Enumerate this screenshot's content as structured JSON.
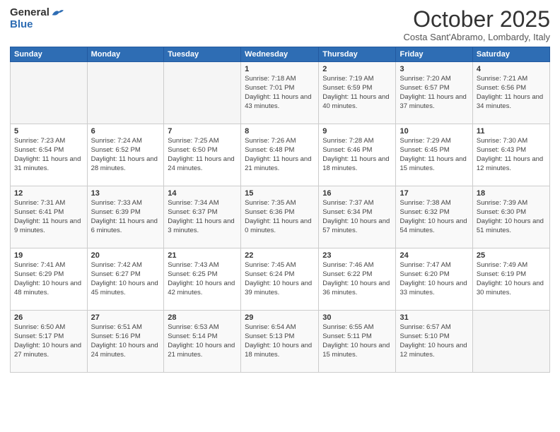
{
  "header": {
    "logo_general": "General",
    "logo_blue": "Blue",
    "month": "October 2025",
    "location": "Costa Sant'Abramo, Lombardy, Italy"
  },
  "days_of_week": [
    "Sunday",
    "Monday",
    "Tuesday",
    "Wednesday",
    "Thursday",
    "Friday",
    "Saturday"
  ],
  "weeks": [
    [
      {
        "day": "",
        "info": ""
      },
      {
        "day": "",
        "info": ""
      },
      {
        "day": "",
        "info": ""
      },
      {
        "day": "1",
        "info": "Sunrise: 7:18 AM\nSunset: 7:01 PM\nDaylight: 11 hours and 43 minutes."
      },
      {
        "day": "2",
        "info": "Sunrise: 7:19 AM\nSunset: 6:59 PM\nDaylight: 11 hours and 40 minutes."
      },
      {
        "day": "3",
        "info": "Sunrise: 7:20 AM\nSunset: 6:57 PM\nDaylight: 11 hours and 37 minutes."
      },
      {
        "day": "4",
        "info": "Sunrise: 7:21 AM\nSunset: 6:56 PM\nDaylight: 11 hours and 34 minutes."
      }
    ],
    [
      {
        "day": "5",
        "info": "Sunrise: 7:23 AM\nSunset: 6:54 PM\nDaylight: 11 hours and 31 minutes."
      },
      {
        "day": "6",
        "info": "Sunrise: 7:24 AM\nSunset: 6:52 PM\nDaylight: 11 hours and 28 minutes."
      },
      {
        "day": "7",
        "info": "Sunrise: 7:25 AM\nSunset: 6:50 PM\nDaylight: 11 hours and 24 minutes."
      },
      {
        "day": "8",
        "info": "Sunrise: 7:26 AM\nSunset: 6:48 PM\nDaylight: 11 hours and 21 minutes."
      },
      {
        "day": "9",
        "info": "Sunrise: 7:28 AM\nSunset: 6:46 PM\nDaylight: 11 hours and 18 minutes."
      },
      {
        "day": "10",
        "info": "Sunrise: 7:29 AM\nSunset: 6:45 PM\nDaylight: 11 hours and 15 minutes."
      },
      {
        "day": "11",
        "info": "Sunrise: 7:30 AM\nSunset: 6:43 PM\nDaylight: 11 hours and 12 minutes."
      }
    ],
    [
      {
        "day": "12",
        "info": "Sunrise: 7:31 AM\nSunset: 6:41 PM\nDaylight: 11 hours and 9 minutes."
      },
      {
        "day": "13",
        "info": "Sunrise: 7:33 AM\nSunset: 6:39 PM\nDaylight: 11 hours and 6 minutes."
      },
      {
        "day": "14",
        "info": "Sunrise: 7:34 AM\nSunset: 6:37 PM\nDaylight: 11 hours and 3 minutes."
      },
      {
        "day": "15",
        "info": "Sunrise: 7:35 AM\nSunset: 6:36 PM\nDaylight: 11 hours and 0 minutes."
      },
      {
        "day": "16",
        "info": "Sunrise: 7:37 AM\nSunset: 6:34 PM\nDaylight: 10 hours and 57 minutes."
      },
      {
        "day": "17",
        "info": "Sunrise: 7:38 AM\nSunset: 6:32 PM\nDaylight: 10 hours and 54 minutes."
      },
      {
        "day": "18",
        "info": "Sunrise: 7:39 AM\nSunset: 6:30 PM\nDaylight: 10 hours and 51 minutes."
      }
    ],
    [
      {
        "day": "19",
        "info": "Sunrise: 7:41 AM\nSunset: 6:29 PM\nDaylight: 10 hours and 48 minutes."
      },
      {
        "day": "20",
        "info": "Sunrise: 7:42 AM\nSunset: 6:27 PM\nDaylight: 10 hours and 45 minutes."
      },
      {
        "day": "21",
        "info": "Sunrise: 7:43 AM\nSunset: 6:25 PM\nDaylight: 10 hours and 42 minutes."
      },
      {
        "day": "22",
        "info": "Sunrise: 7:45 AM\nSunset: 6:24 PM\nDaylight: 10 hours and 39 minutes."
      },
      {
        "day": "23",
        "info": "Sunrise: 7:46 AM\nSunset: 6:22 PM\nDaylight: 10 hours and 36 minutes."
      },
      {
        "day": "24",
        "info": "Sunrise: 7:47 AM\nSunset: 6:20 PM\nDaylight: 10 hours and 33 minutes."
      },
      {
        "day": "25",
        "info": "Sunrise: 7:49 AM\nSunset: 6:19 PM\nDaylight: 10 hours and 30 minutes."
      }
    ],
    [
      {
        "day": "26",
        "info": "Sunrise: 6:50 AM\nSunset: 5:17 PM\nDaylight: 10 hours and 27 minutes."
      },
      {
        "day": "27",
        "info": "Sunrise: 6:51 AM\nSunset: 5:16 PM\nDaylight: 10 hours and 24 minutes."
      },
      {
        "day": "28",
        "info": "Sunrise: 6:53 AM\nSunset: 5:14 PM\nDaylight: 10 hours and 21 minutes."
      },
      {
        "day": "29",
        "info": "Sunrise: 6:54 AM\nSunset: 5:13 PM\nDaylight: 10 hours and 18 minutes."
      },
      {
        "day": "30",
        "info": "Sunrise: 6:55 AM\nSunset: 5:11 PM\nDaylight: 10 hours and 15 minutes."
      },
      {
        "day": "31",
        "info": "Sunrise: 6:57 AM\nSunset: 5:10 PM\nDaylight: 10 hours and 12 minutes."
      },
      {
        "day": "",
        "info": ""
      }
    ]
  ]
}
